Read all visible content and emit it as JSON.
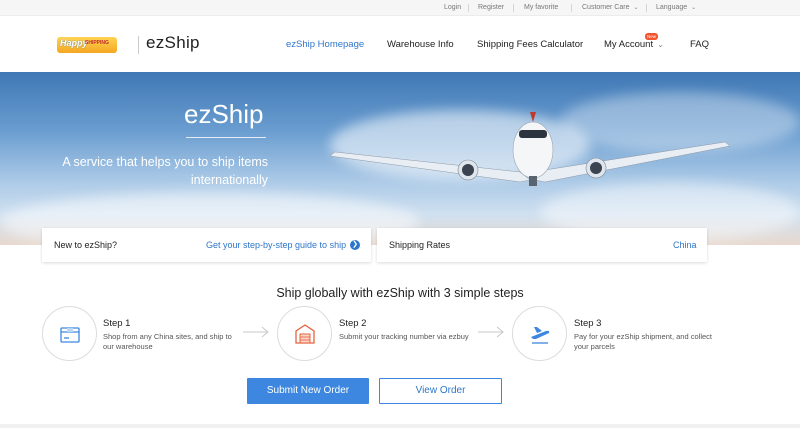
{
  "topbar": {
    "login": "Login",
    "register": "Register",
    "favorite": "My favorite",
    "customer_care": "Customer Care",
    "language": "Language"
  },
  "header": {
    "partner_logo_text": "Happy SHIPPING",
    "brand": "ezShip",
    "nav": {
      "home": "ezShip Homepage",
      "warehouse": "Warehouse Info",
      "fees": "Shipping Fees Calculator",
      "account": "My Account",
      "faq": "FAQ"
    },
    "account_badge": "New"
  },
  "banner": {
    "title": "ezShip",
    "tagline_line1": "A service that helps you to ship items",
    "tagline_line2": "internationally"
  },
  "cards": {
    "new_user_label": "New to ezShip?",
    "guide_link": "Get your step-by-step guide to ship",
    "rates_label": "Shipping Rates",
    "rates_country": "China"
  },
  "steps": {
    "title": "Ship globally with ezShip with 3 simple steps",
    "items": [
      {
        "head": "Step 1",
        "desc": "Shop from any China sites, and ship to our warehouse",
        "icon": "package-icon"
      },
      {
        "head": "Step 2",
        "desc": "Submit your tracking number via ezbuy",
        "icon": "warehouse-icon"
      },
      {
        "head": "Step 3",
        "desc": "Pay for your ezShip shipment, and collect your parcels",
        "icon": "airplane-icon"
      }
    ]
  },
  "actions": {
    "submit": "Submit New Order",
    "view": "View Order"
  },
  "colors": {
    "accent": "#3d87e0",
    "link": "#2f76c9",
    "badge": "#f2542d"
  }
}
